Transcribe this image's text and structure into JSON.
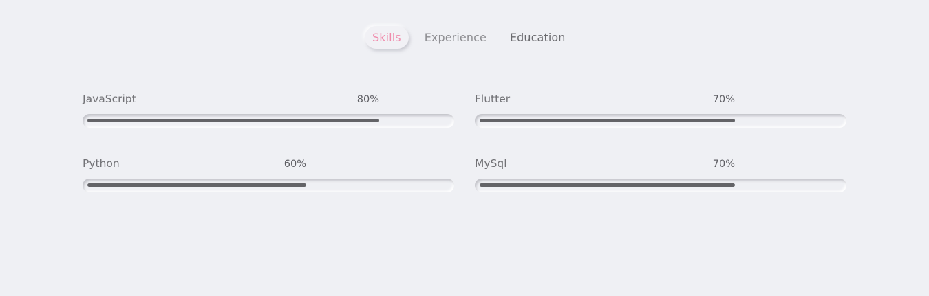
{
  "tabs": [
    {
      "label": "Skills",
      "active": true,
      "color": "#f08aab"
    },
    {
      "label": "Experience",
      "active": false,
      "color": "#8d8d91"
    },
    {
      "label": "Education",
      "active": false,
      "color": "#6b6b6f"
    }
  ],
  "skills": [
    {
      "name": "JavaScript",
      "percent_label": "80%",
      "level": 0.8
    },
    {
      "name": "Flutter",
      "percent_label": "70%",
      "level": 0.7
    },
    {
      "name": "Python",
      "percent_label": "60%",
      "level": 0.6
    },
    {
      "name": "MySql",
      "percent_label": "70%",
      "level": 0.7
    }
  ],
  "colors": {
    "background": "#eff0f4",
    "bar_fill": "#636367",
    "accent": "#f08aab"
  }
}
